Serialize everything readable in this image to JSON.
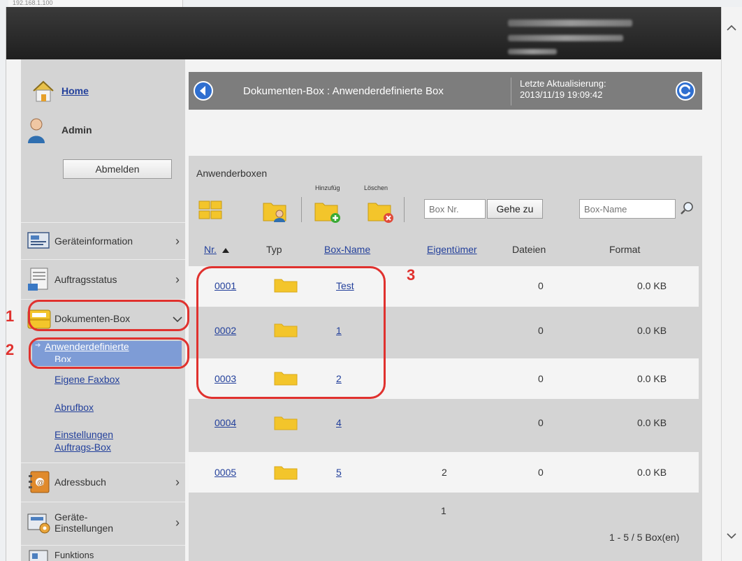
{
  "browser": {
    "tab_title": "192.168.1.100",
    "scroll_up_icon": "chevron-up-icon",
    "scroll_down_icon": "chevron-down-icon"
  },
  "sidebar": {
    "home_label": "Home",
    "user_label": "Admin",
    "logout_label": "Abmelden",
    "items": [
      {
        "label": "Geräteinformation",
        "icon": "device-info-icon"
      },
      {
        "label": "Auftragsstatus",
        "icon": "job-status-icon"
      },
      {
        "label": "Dokumenten-Box",
        "icon": "document-box-icon"
      },
      {
        "label": "Adressbuch",
        "icon": "address-book-icon"
      },
      {
        "label": "Geräte-",
        "label2": "Einstellungen",
        "icon": "device-settings-icon"
      },
      {
        "label": "Funktions",
        "icon": "functions-icon"
      }
    ],
    "subitems": {
      "custom_box_1": "Anwenderdefinierte",
      "custom_box_2": "Box",
      "fax_box": "Eigene Faxbox",
      "polling_box": "Abrufbox",
      "job_box_1": "Einstellungen",
      "job_box_2": "Auftrags-Box"
    }
  },
  "titlebar": {
    "breadcrumb": "Dokumenten-Box : Anwenderdefinierte Box",
    "updated_label": "Letzte Aktualisierung:",
    "updated_value": "2013/11/19 19:09:42"
  },
  "panel": {
    "title": "Anwenderboxen",
    "add_label": "Hinzufüg",
    "delete_label": "Löschen",
    "box_nr_placeholder": "Box Nr.",
    "goto_label": "Gehe zu",
    "box_name_placeholder": "Box-Name"
  },
  "table": {
    "headers": {
      "nr": "Nr.",
      "typ": "Typ",
      "name": "Box-Name",
      "owner": "Eigentümer",
      "files": "Dateien",
      "format": "Format"
    },
    "rows": [
      {
        "nr": "0001",
        "name": "Test",
        "owner": "",
        "files": "0",
        "format": "0.0 KB"
      },
      {
        "nr": "0002",
        "name": "1",
        "owner": "",
        "files": "0",
        "format": "0.0 KB"
      },
      {
        "nr": "0003",
        "name": "2",
        "owner": "",
        "files": "0",
        "format": "0.0 KB"
      },
      {
        "nr": "0004",
        "name": "4",
        "owner": "",
        "files": "0",
        "format": "0.0 KB"
      },
      {
        "nr": "0005",
        "name": "5",
        "owner": "2",
        "files": "0",
        "format": "0.0 KB"
      }
    ],
    "page": "1",
    "summary": "1 - 5 / 5 Box(en)"
  },
  "annotations": {
    "one": "1",
    "two": "2",
    "three": "3"
  },
  "colors": {
    "link": "#23409b",
    "annotation": "#e0312e",
    "titlebar": "#7d7d7d",
    "panel": "#d4d4d4"
  }
}
